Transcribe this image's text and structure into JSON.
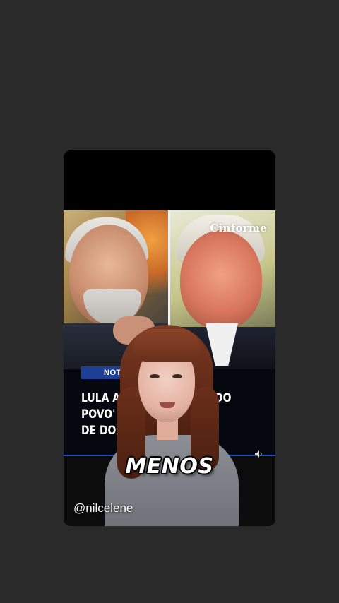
{
  "video": {
    "source_logo": "Cinforme",
    "news_badge": "NOTÍCIA",
    "headline_lines": [
      "LULA AFIRMA 'O BOLSO DO",
      "POVO' PAGARÁ A TARIFA",
      "DE DOLAR"
    ],
    "caption_word": "MENOS",
    "handle": "@nilcelene"
  },
  "icons": {
    "volume": "volume-icon"
  },
  "colors": {
    "background": "#2a2a2a",
    "news_badge": "#1d3f96",
    "progress_line": "#1f4fb8"
  }
}
